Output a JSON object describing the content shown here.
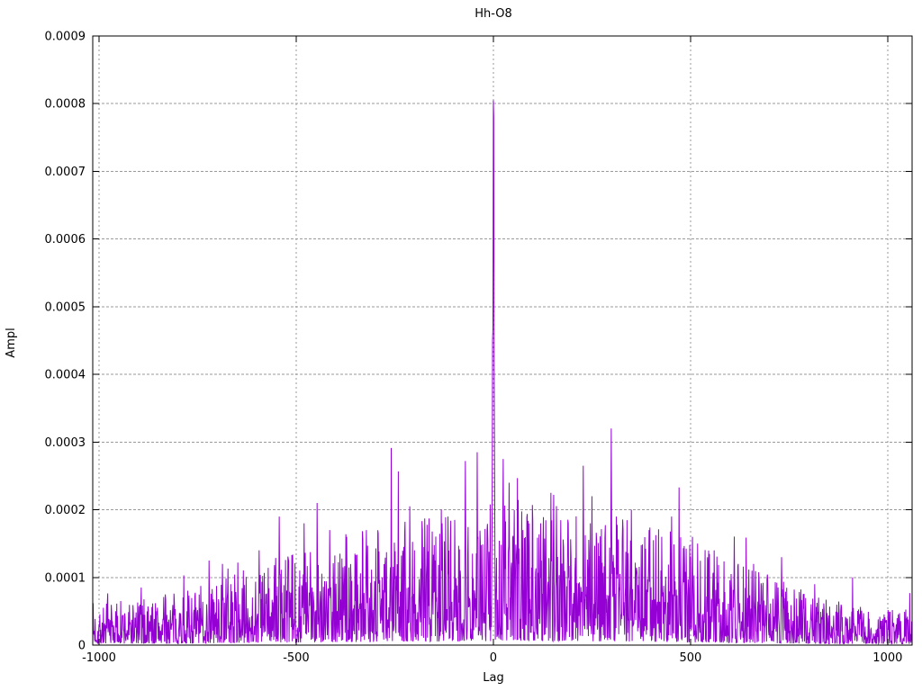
{
  "chart_data": {
    "type": "line",
    "title": "Hh-O8",
    "xlabel": "Lag",
    "ylabel": "Ampl",
    "xlim": [
      -1016,
      1062
    ],
    "ylim": [
      0,
      0.0009
    ],
    "xticks": [
      -1000,
      -500,
      0,
      500,
      1000
    ],
    "xtick_labels": [
      "-1000",
      "-500",
      "0",
      "500",
      "1000"
    ],
    "yticks": [
      0,
      0.0001,
      0.0002,
      0.0003,
      0.0004,
      0.0005,
      0.0006,
      0.0007,
      0.0008,
      0.0009
    ],
    "ytick_labels": [
      "0",
      "0.0001",
      "0.0002",
      "0.0003",
      "0.0004",
      "0.0005",
      "0.0006",
      "0.0007",
      "0.0008",
      "0.0009"
    ],
    "grid": true,
    "legend": false,
    "line_color": "#9400d3",
    "grid_color": "#9a9a9a",
    "border_color": "#000000",
    "background_color": "#ffffff",
    "series_name": "Hh-O8",
    "n_points": 2079,
    "noise_seed": 7,
    "main_peak": {
      "lag": 0,
      "ampl": 0.000805,
      "profile_lags": [
        -4,
        -3,
        -2,
        -1,
        0,
        1,
        2,
        3,
        4
      ],
      "profile": [
        0.00012,
        0.0002,
        0.00045,
        0.00047,
        0.000805,
        0.00078,
        0.00042,
        0.00028,
        0.00014
      ]
    },
    "notable_peaks": [
      [
        -721,
        0.000125
      ],
      [
        -687,
        0.00012
      ],
      [
        -594,
        0.00014
      ],
      [
        -543,
        0.00019
      ],
      [
        -480,
        0.00018
      ],
      [
        -447,
        0.00021
      ],
      [
        -415,
        0.00017
      ],
      [
        -372,
        0.00016
      ],
      [
        -322,
        0.00017
      ],
      [
        -292,
        0.000165
      ],
      [
        -212,
        0.000205
      ],
      [
        -180,
        0.00017
      ],
      [
        -132,
        0.0002
      ],
      [
        -115,
        0.00019
      ],
      [
        -98,
        0.000185
      ],
      [
        -71,
        0.000272
      ],
      [
        -41,
        0.000285
      ],
      [
        -14,
        0.000155
      ],
      [
        25,
        0.000275
      ],
      [
        40,
        0.00024
      ],
      [
        75,
        0.00017
      ],
      [
        120,
        0.00018
      ],
      [
        146,
        0.000225
      ],
      [
        153,
        0.000222
      ],
      [
        190,
        0.00018
      ],
      [
        228,
        0.000265
      ],
      [
        250,
        0.00022
      ],
      [
        299,
        0.00032
      ],
      [
        312,
        0.00019
      ],
      [
        350,
        0.0002
      ],
      [
        395,
        0.00017
      ],
      [
        427,
        0.00016
      ],
      [
        452,
        0.00019
      ],
      [
        505,
        0.00016
      ],
      [
        518,
        0.00015
      ],
      [
        560,
        0.00014
      ],
      [
        621,
        0.00012
      ],
      [
        660,
        0.00012
      ],
      [
        731,
        0.00013
      ],
      [
        815,
        9e-05
      ]
    ],
    "noise_envelope": [
      [
        -1016,
        3e-05
      ],
      [
        -900,
        3.2e-05
      ],
      [
        -800,
        3.6e-05
      ],
      [
        -700,
        4.5e-05
      ],
      [
        -600,
        5.5e-05
      ],
      [
        -500,
        6.5e-05
      ],
      [
        -400,
        7.5e-05
      ],
      [
        -300,
        8.2e-05
      ],
      [
        -200,
        8.8e-05
      ],
      [
        -100,
        9.2e-05
      ],
      [
        0,
        0.0001
      ],
      [
        100,
        0.0001
      ],
      [
        200,
        9.8e-05
      ],
      [
        300,
        9.2e-05
      ],
      [
        400,
        8.5e-05
      ],
      [
        500,
        7.2e-05
      ],
      [
        600,
        6e-05
      ],
      [
        700,
        4.8e-05
      ],
      [
        800,
        3.6e-05
      ],
      [
        900,
        2.8e-05
      ],
      [
        1062,
        2.4e-05
      ]
    ]
  }
}
